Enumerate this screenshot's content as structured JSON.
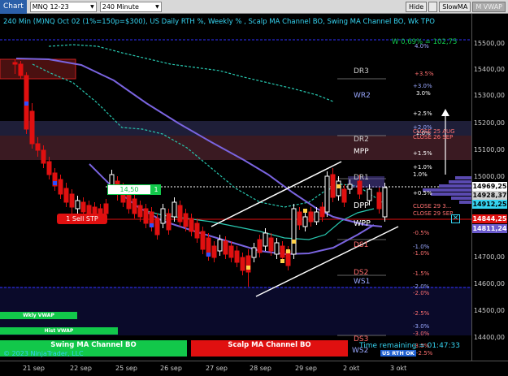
{
  "toolbar": {
    "chart_label": "Chart",
    "instrument": "MNQ 12-23",
    "interval": "240 Minute",
    "hide_label": "Hide",
    "slow_ma_label": "SlowMA",
    "m_vwap_label": "M VWAP"
  },
  "chart_title": "240 Min (M)NQ Oct 02 (1%=150p=$300), US Daily RTH %, Weekly % , Scalp MA Channel BO, Swing MA Channel BO, Wk TPO",
  "price_axis": {
    "ticks": [
      "15500,00",
      "15400,00",
      "15300,00",
      "15200,00",
      "15100,00",
      "15000,00",
      "14700,00",
      "14600,00",
      "14500,00",
      "14400,00"
    ]
  },
  "price_tags": [
    {
      "text": "14969,25",
      "bg": "#ffffff",
      "fg": "#000000"
    },
    {
      "text": "14928,37",
      "bg": "#d0d0d0",
      "fg": "#000000"
    },
    {
      "text": "14912,25",
      "bg": "#35d3f0",
      "fg": "#000000"
    },
    {
      "text": "14844,25",
      "bg": "#e01010",
      "fg": "#ffffff"
    },
    {
      "text": "14811,24",
      "bg": "#6a5acd",
      "fg": "#ffffff"
    }
  ],
  "time_axis": {
    "ticks": [
      "21 sep",
      "22 sep",
      "25 sep",
      "26 sep",
      "27 sep",
      "28 sep",
      "29 sep",
      "2 okt",
      "3 okt"
    ]
  },
  "level_labels": {
    "dr3": "DR3",
    "wr2": "WR2",
    "dr2": "DR2",
    "mpp": "MPP",
    "dr1": "DR1",
    "dpp": "DPP",
    "wpp": "WPP",
    "ds1": "DS1",
    "ds2": "DS2",
    "ws1": "WS1",
    "ds3": "DS3",
    "ws2": "WS2"
  },
  "pct_labels": {
    "p40": "4.0%",
    "p35": "+3.5%",
    "p30b": "+3.0%",
    "p30w": "3.0%",
    "p25": "+2.5%",
    "p20b": "+2.0%",
    "p20w": "2.0%",
    "p15": "+1.5%",
    "p10b": "+1.0%",
    "p10w": "1.0%",
    "p05": "+0.5%",
    "m05": "-0.5%",
    "m10a": "-1.0%",
    "m10b": "-1.0%",
    "m15": "-1.5%",
    "m20a": "-2.0%",
    "m20b": "-2.0%",
    "m25": "-2.5%",
    "m30a": "-3.0%",
    "m30b": "-3.0%",
    "m35": "-3.5%",
    "m25b": "-2.5%"
  },
  "annotations": {
    "weekly": "W 0,69% = 102,75",
    "close_aug": "CLOSE 25 AUG",
    "close_sep": "CLOSE 26 SEP",
    "close_293": "CLOSE 29 3...",
    "close_29sep": "CLOSE 29 SEP",
    "sell_stop": "1 Sell STP",
    "order_price": "14,50",
    "order_qty": "1",
    "copyright": "© 2023 NinjaTrader, LLC",
    "time_remaining": "Time remaining = 01:47:33",
    "us_rth": "US RTH OK"
  },
  "bottom_bars": {
    "wkly_vwap": "Wkly VWAP",
    "hist_vwap": "Hist VWAP",
    "swing": "Swing MA Channel BO",
    "scalp": "Scalp MA Channel BO"
  },
  "colors": {
    "up": "#ffffff",
    "down": "#e01010",
    "ma_purple": "#7a64e0",
    "teal": "#28c8b0",
    "blue_dash": "#3030ff",
    "green": "#12c84a",
    "red_bar": "#e01010",
    "cyan": "#35d3f0"
  }
}
